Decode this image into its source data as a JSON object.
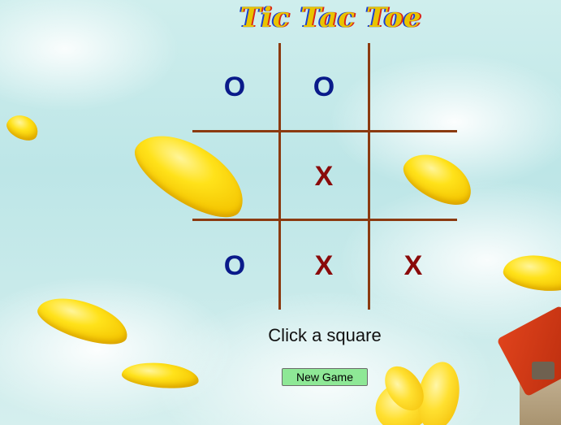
{
  "title": "Tic Tac Toe",
  "board": {
    "cells": [
      "O",
      "O",
      "",
      "",
      "X",
      "",
      "O",
      "X",
      "X"
    ]
  },
  "status": "Click a square",
  "new_game_label": "New Game",
  "colors": {
    "o_mark": "#0a1a8a",
    "x_mark": "#8a0a0a",
    "grid_line": "#8b3a10",
    "button_bg": "#8ee896"
  }
}
